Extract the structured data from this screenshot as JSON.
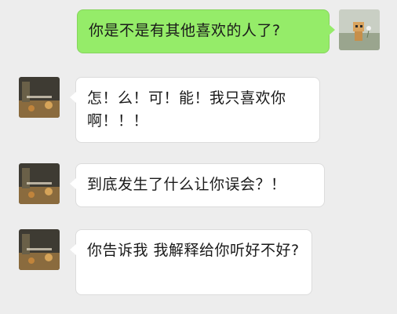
{
  "conversation": {
    "messages": [
      {
        "sender": "me",
        "avatar": "avatar-danbo",
        "text": "你是不是有其他喜欢的人了?"
      },
      {
        "sender": "contact",
        "avatar": "avatar-street",
        "text": "怎！么！可！能！我只喜欢你啊！！！"
      },
      {
        "sender": "contact",
        "avatar": "avatar-street",
        "text": "到底发生了什么让你误会？！"
      },
      {
        "sender": "contact",
        "avatar": "avatar-street",
        "text": "你告诉我 我解释给你听好不好?"
      }
    ]
  },
  "colors": {
    "background": "#ededed",
    "outgoing_bubble": "#95ec69",
    "incoming_bubble": "#ffffff"
  }
}
